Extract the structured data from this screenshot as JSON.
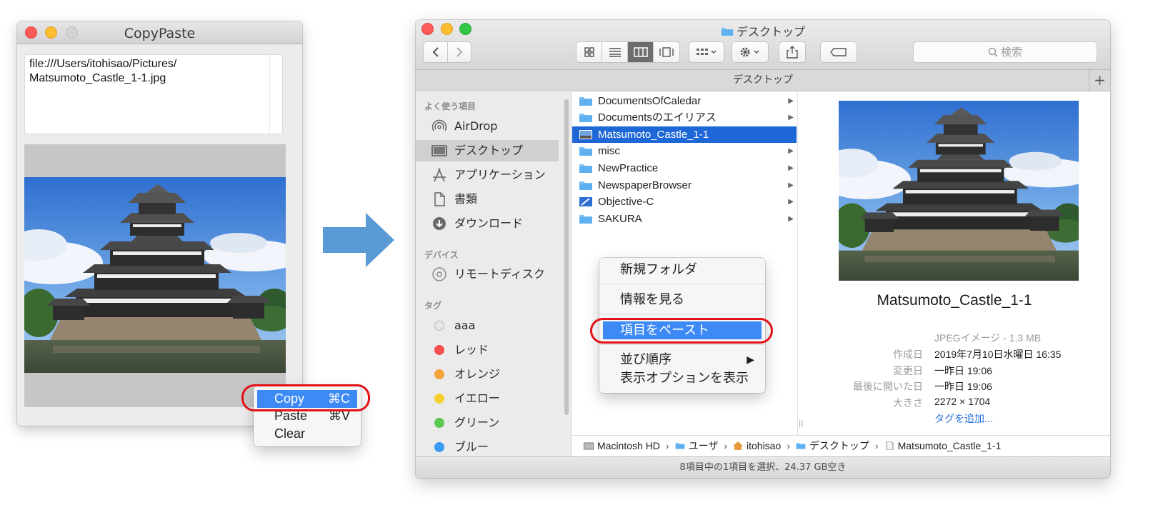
{
  "copypaste": {
    "title": "CopyPaste",
    "text_line1": "file:///Users/itohisao/Pictures/",
    "text_line2": "Matsumoto_Castle_1-1.jpg",
    "image_name": "castle-photo"
  },
  "edit_menu": {
    "items": [
      {
        "label": "Copy",
        "shortcut": "⌘C",
        "selected": true
      },
      {
        "label": "Paste",
        "shortcut": "⌘V"
      },
      {
        "label": "Clear",
        "shortcut": ""
      }
    ]
  },
  "finder": {
    "title": "デスクトップ",
    "tab_title": "デスクトップ",
    "search_placeholder": "検索",
    "sidebar": {
      "favorites_header": "よく使う項目",
      "favorites": [
        "AirDrop",
        "デスクトップ",
        "アプリケーション",
        "書類",
        "ダウンロード"
      ],
      "devices_header": "デバイス",
      "devices": [
        "リモートディスク"
      ],
      "tags_header": "タグ",
      "tags": [
        {
          "label": "aaa",
          "color": "#e6e6e6"
        },
        {
          "label": "レッド",
          "color": "#f74f4f"
        },
        {
          "label": "オレンジ",
          "color": "#f5a33b"
        },
        {
          "label": "イエロー",
          "color": "#f7d02f"
        },
        {
          "label": "グリーン",
          "color": "#5bc94f"
        },
        {
          "label": "ブルー",
          "color": "#3b9cf5"
        }
      ]
    },
    "files": [
      {
        "name": "DocumentsOfCaledar",
        "arrow": "▶"
      },
      {
        "name": "Documentsのエイリアス",
        "arrow": "▶"
      },
      {
        "name": "Matsumoto_Castle_1-1",
        "arrow": "",
        "selected": true
      },
      {
        "name": "misc",
        "arrow": "▶"
      },
      {
        "name": "NewPractice",
        "arrow": "▶"
      },
      {
        "name": "NewspaperBrowser",
        "arrow": "▶"
      },
      {
        "name": "Objective-C",
        "arrow": "▶"
      },
      {
        "name": "SAKURA",
        "arrow": "▶"
      }
    ],
    "context_menu": {
      "new_folder": "新規フォルダ",
      "get_info": "情報を見る",
      "paste_item": "項目をペースト",
      "sort_by": "並び順序",
      "sort_arrow": "▶",
      "view_options": "表示オプションを表示"
    },
    "preview": {
      "name": "Matsumoto_Castle_1-1",
      "kind": "JPEGイメージ - 1.3 MB",
      "created_label": "作成日",
      "created_value": "2019年7月10日水曜日 16:35",
      "modified_label": "変更日",
      "modified_value": "一昨日 19:06",
      "opened_label": "最後に開いた日",
      "opened_value": "一昨日 19:06",
      "size_label": "大きさ",
      "size_value": "2272 × 1704",
      "add_tag": "タグを追加..."
    },
    "pathbar": [
      "Macintosh HD",
      "ユーザ",
      "itohisao",
      "デスクトップ",
      "Matsumoto_Castle_1-1"
    ],
    "path_sep": "›",
    "status": "8項目中の1項目を選択、24.37 GB空き"
  },
  "colors": {
    "selection_blue": "#1e67d7",
    "menu_highlight": "#3d8af6",
    "highlight_ring": "#e31018",
    "arrow_blue": "#5b9bd5"
  }
}
